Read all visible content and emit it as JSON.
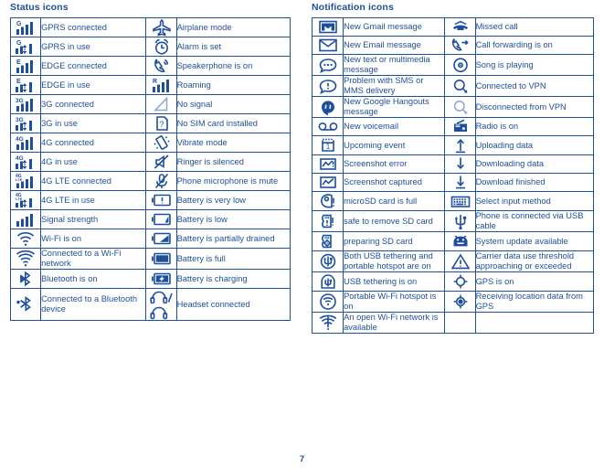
{
  "document": {
    "page_number": "7",
    "accent_color": "#1e4f9c",
    "faded_color": "#8fa6cf"
  },
  "status": {
    "title": "Status icons",
    "rows": [
      {
        "icon_a": "gprs-connected-icon",
        "label_a": "GPRS connected",
        "icon_b": "airplane-mode-icon",
        "label_b": "Airplane mode"
      },
      {
        "icon_a": "gprs-in-use-icon",
        "label_a": "GPRS in use",
        "icon_b": "alarm-clock-icon",
        "label_b": "Alarm is set"
      },
      {
        "icon_a": "edge-connected-icon",
        "label_a": "EDGE connected",
        "icon_b": "speakerphone-icon",
        "label_b": "Speakerphone is on"
      },
      {
        "icon_a": "edge-in-use-icon",
        "label_a": "EDGE in use",
        "icon_b": "roaming-icon",
        "label_b": "Roaming"
      },
      {
        "icon_a": "3g-connected-icon",
        "label_a": "3G connected",
        "icon_b": "no-signal-icon",
        "label_b": "No signal"
      },
      {
        "icon_a": "3g-in-use-icon",
        "label_a": "3G in use",
        "icon_b": "no-sim-card-icon",
        "label_b": "No SIM card installed"
      },
      {
        "icon_a": "4g-connected-icon",
        "label_a": "4G connected",
        "icon_b": "vibrate-mode-icon",
        "label_b": "Vibrate mode"
      },
      {
        "icon_a": "4g-in-use-icon",
        "label_a": "4G in use",
        "icon_b": "ringer-silenced-icon",
        "label_b": "Ringer is silenced"
      },
      {
        "icon_a": "4g-lte-connected-icon",
        "label_a": "4G LTE connected",
        "icon_b": "microphone-mute-icon",
        "label_b": "Phone microphone is mute"
      },
      {
        "icon_a": "4g-lte-in-use-icon",
        "label_a": "4G LTE in use",
        "icon_b": "battery-very-low-icon",
        "label_b": "Battery is very low"
      },
      {
        "icon_a": "signal-strength-icon",
        "label_a": "Signal strength",
        "icon_b": "battery-low-icon",
        "label_b": "Battery is low"
      },
      {
        "icon_a": "wifi-on-icon",
        "label_a": "Wi-Fi is on",
        "icon_b": "battery-partial-icon",
        "label_b": "Battery is partially drained"
      },
      {
        "icon_a": "wifi-connected-icon",
        "label_a": "Connected to a Wi-Fi network",
        "icon_b": "battery-full-icon",
        "label_b": "Battery is full"
      },
      {
        "icon_a": "bluetooth-on-icon",
        "label_a": "Bluetooth is on",
        "icon_b": "battery-charging-icon",
        "label_b": "Battery is charging"
      },
      {
        "icon_a": "bluetooth-connected-icon",
        "label_a": "Connected to a Bluetooth device",
        "icon_b": "headset-icon",
        "label_b": "Headset connected"
      }
    ]
  },
  "notification": {
    "title": "Notification icons",
    "rows": [
      {
        "icon_a": "gmail-icon",
        "label_a": "New Gmail message",
        "icon_b": "missed-call-icon",
        "label_b": "Missed call"
      },
      {
        "icon_a": "email-icon",
        "label_a": "New Email message",
        "icon_b": "call-forwarding-icon",
        "label_b": "Call forwarding is on"
      },
      {
        "icon_a": "sms-mms-icon",
        "label_a": "New text or multimedia message",
        "icon_b": "song-playing-icon",
        "label_b": "Song is playing"
      },
      {
        "icon_a": "sms-problem-icon",
        "label_a": "Problem with SMS or MMS delivery",
        "icon_b": "vpn-connected-icon",
        "label_b": "Connected to VPN"
      },
      {
        "icon_a": "hangouts-icon",
        "label_a": "New Google Hangouts message",
        "icon_b": "vpn-disconnected-icon",
        "label_b": "Disconnected from VPN"
      },
      {
        "icon_a": "voicemail-icon",
        "label_a": "New voicemail",
        "icon_b": "radio-icon",
        "label_b": "Radio is on"
      },
      {
        "icon_a": "calendar-event-icon",
        "label_a": "Upcoming event",
        "icon_b": "upload-icon",
        "label_b": "Uploading data"
      },
      {
        "icon_a": "screenshot-error-icon",
        "label_a": "Screenshot error",
        "icon_b": "download-icon",
        "label_b": "Downloading data"
      },
      {
        "icon_a": "screenshot-captured-icon",
        "label_a": " Screenshot captured",
        "icon_b": "download-finished-icon",
        "label_b": "Download finished"
      },
      {
        "icon_a": "sd-card-full-icon",
        "label_a": "microSD card is full",
        "icon_b": "keyboard-icon",
        "label_b": "Select input method"
      },
      {
        "icon_a": "sd-card-safe-remove-icon",
        "label_a": "safe to remove SD card",
        "icon_b": "usb-icon",
        "label_b": "Phone is connected via USB cable"
      },
      {
        "icon_a": "sd-card-preparing-icon",
        "label_a": "preparing SD card",
        "icon_b": "android-update-icon",
        "label_b": "System update available"
      },
      {
        "icon_a": "usb-tethering-hotspot-icon",
        "label_a": "Both USB tethering and portable hotspot are on",
        "icon_b": "warning-icon",
        "label_b": "Carrier data use threshold approaching or exceeded"
      },
      {
        "icon_a": "usb-tethering-icon",
        "label_a": "USB tethering is on",
        "icon_b": "gps-on-icon",
        "label_b": "GPS is on"
      },
      {
        "icon_a": "portable-hotspot-icon",
        "label_a": "Portable Wi-Fi hotspot is on",
        "icon_b": "gps-receiving-icon",
        "label_b": "Receiving location data from GPS"
      },
      {
        "icon_a": "open-wifi-icon",
        "label_a": "An open Wi-Fi network is available",
        "icon_b": "",
        "label_b": ""
      }
    ]
  }
}
